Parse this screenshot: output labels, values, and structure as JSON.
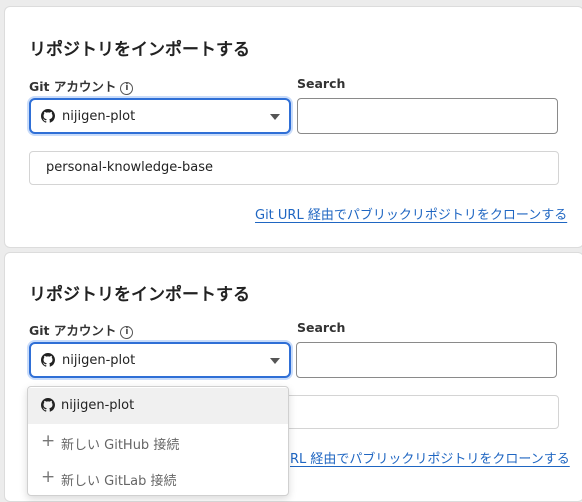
{
  "panel1": {
    "title": "リポジトリをインポートする",
    "git_account_label": "Git アカウント",
    "info_glyph": "i",
    "search_label": "Search",
    "account_value": "nijigen-plot",
    "repository_value": "personal-knowledge-base",
    "clone_link": "Git URL 経由でパブリックリポジトリをクローンする"
  },
  "panel2": {
    "title": "リポジトリをインポートする",
    "git_account_label": "Git アカウント",
    "info_glyph": "i",
    "search_label": "Search",
    "account_value": "nijigen-plot",
    "clone_link": "RL 経由でパブリックリポジトリをクローンする"
  },
  "dropdown": {
    "options": [
      {
        "label": "nijigen-plot",
        "icon": "github-icon",
        "selected": true
      },
      {
        "label": "新しい GitHub 接続",
        "icon": "plus-icon"
      },
      {
        "label": "新しい GitLab 接続",
        "icon": "plus-icon"
      }
    ]
  },
  "colors": {
    "focus_border": "#2f6fd6",
    "link": "#1f66c2"
  }
}
